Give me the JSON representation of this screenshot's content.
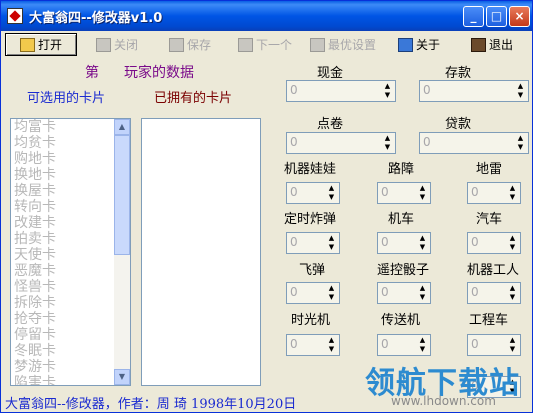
{
  "window": {
    "title": "大富翁四--修改器v1.0",
    "controls": {
      "minimize": "_",
      "maximize": "□",
      "close": "×"
    }
  },
  "toolbar": {
    "open": "打开",
    "close": "关闭",
    "save": "保存",
    "next": "下一个",
    "optimal": "最优设置",
    "about": "关于",
    "exit": "退出"
  },
  "players": {
    "index_label": "第",
    "data_label": "玩家的数据"
  },
  "cards": {
    "available_label": "可选用的卡片",
    "owned_label": "已拥有的卡片",
    "available_items": [
      "均富卡",
      "均贫卡",
      "购地卡",
      "换地卡",
      "换屋卡",
      "转向卡",
      "改建卡",
      "拍卖卡",
      "天使卡",
      "恶魔卡",
      "怪兽卡",
      "拆除卡",
      "抢夺卡",
      "停留卡",
      "冬眠卡",
      "梦游卡",
      "陷害卡"
    ],
    "owned_items": []
  },
  "fields": {
    "cash": {
      "label": "现金",
      "value": "0"
    },
    "deposit": {
      "label": "存款",
      "value": "0"
    },
    "points": {
      "label": "点卷",
      "value": "0"
    },
    "loan": {
      "label": "贷款",
      "value": "0"
    },
    "robot_doll": {
      "label": "机器娃娃",
      "value": "0"
    },
    "roadblock": {
      "label": "路障",
      "value": "0"
    },
    "mine": {
      "label": "地雷",
      "value": "0"
    },
    "time_bomb": {
      "label": "定时炸弹",
      "value": "0"
    },
    "motorbike": {
      "label": "机车",
      "value": "0"
    },
    "car": {
      "label": "汽车",
      "value": "0"
    },
    "missile": {
      "label": "飞弹",
      "value": "0"
    },
    "rc_dice": {
      "label": "遥控骰子",
      "value": "0"
    },
    "robot_worker": {
      "label": "机器工人",
      "value": "0"
    },
    "time_machine": {
      "label": "时光机",
      "value": "0"
    },
    "teleporter": {
      "label": "传送机",
      "value": "0"
    },
    "engineering_car": {
      "label": "工程车",
      "value": "0"
    },
    "last": {
      "value": "0"
    }
  },
  "status": {
    "text": "大富翁四--修改器，作者：周 琦  1998年10月20日"
  },
  "watermark": {
    "text": "领航下载站",
    "url": "www.lhdown.com"
  }
}
